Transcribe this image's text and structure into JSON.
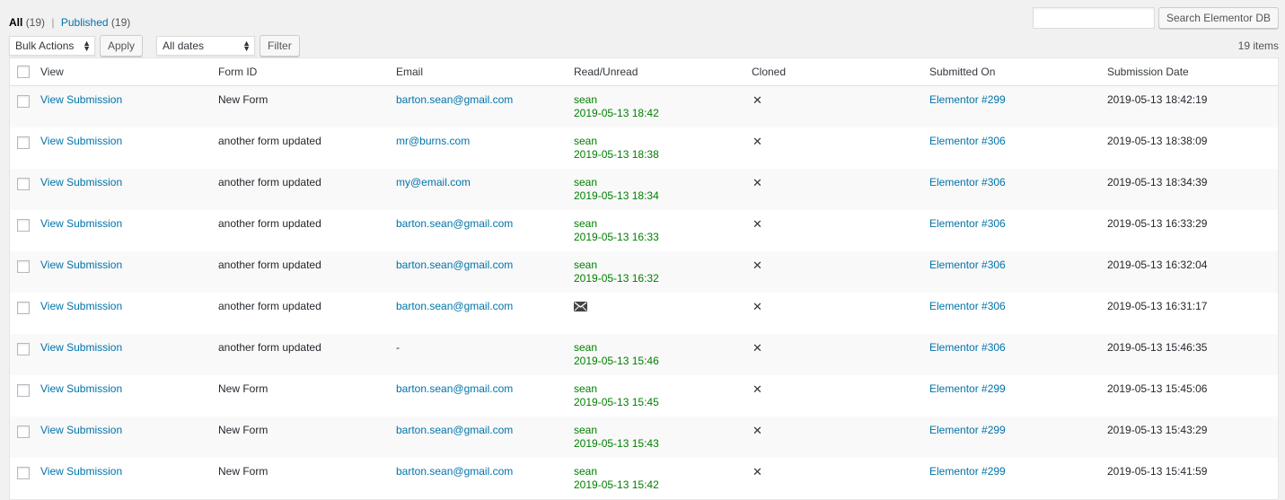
{
  "views": {
    "all_label": "All",
    "all_count": "(19)",
    "separator": "|",
    "published_label": "Published",
    "published_count": "(19)"
  },
  "search": {
    "value": "",
    "button_label": "Search Elementor DB"
  },
  "tablenav": {
    "bulk_actions": "Bulk Actions",
    "apply_label": "Apply",
    "dates": "All dates",
    "filter_label": "Filter",
    "items_count": "19 items"
  },
  "columns": [
    "View",
    "Form ID",
    "Email",
    "Read/Unread",
    "Cloned",
    "Submitted On",
    "Submission Date"
  ],
  "rows": [
    {
      "view": "View Submission",
      "form": "New Form",
      "email": "barton.sean@gmail.com",
      "read_user": "sean",
      "read_time": "2019-05-13 18:42",
      "read": true,
      "cloned": "✕",
      "submitted_on": "Elementor #299",
      "date": "2019-05-13 18:42:19"
    },
    {
      "view": "View Submission",
      "form": "another form updated",
      "email": "mr@burns.com",
      "read_user": "sean",
      "read_time": "2019-05-13 18:38",
      "read": true,
      "cloned": "✕",
      "submitted_on": "Elementor #306",
      "date": "2019-05-13 18:38:09"
    },
    {
      "view": "View Submission",
      "form": "another form updated",
      "email": "my@email.com",
      "read_user": "sean",
      "read_time": "2019-05-13 18:34",
      "read": true,
      "cloned": "✕",
      "submitted_on": "Elementor #306",
      "date": "2019-05-13 18:34:39"
    },
    {
      "view": "View Submission",
      "form": "another form updated",
      "email": "barton.sean@gmail.com",
      "read_user": "sean",
      "read_time": "2019-05-13 16:33",
      "read": true,
      "cloned": "✕",
      "submitted_on": "Elementor #306",
      "date": "2019-05-13 16:33:29"
    },
    {
      "view": "View Submission",
      "form": "another form updated",
      "email": "barton.sean@gmail.com",
      "read_user": "sean",
      "read_time": "2019-05-13 16:32",
      "read": true,
      "cloned": "✕",
      "submitted_on": "Elementor #306",
      "date": "2019-05-13 16:32:04"
    },
    {
      "view": "View Submission",
      "form": "another form updated",
      "email": "barton.sean@gmail.com",
      "read_user": "",
      "read_time": "",
      "read": false,
      "cloned": "✕",
      "submitted_on": "Elementor #306",
      "date": "2019-05-13 16:31:17"
    },
    {
      "view": "View Submission",
      "form": "another form updated",
      "email": "-",
      "read_user": "sean",
      "read_time": "2019-05-13 15:46",
      "read": true,
      "cloned": "✕",
      "submitted_on": "Elementor #306",
      "date": "2019-05-13 15:46:35"
    },
    {
      "view": "View Submission",
      "form": "New Form",
      "email": "barton.sean@gmail.com",
      "read_user": "sean",
      "read_time": "2019-05-13 15:45",
      "read": true,
      "cloned": "✕",
      "submitted_on": "Elementor #299",
      "date": "2019-05-13 15:45:06"
    },
    {
      "view": "View Submission",
      "form": "New Form",
      "email": "barton.sean@gmail.com",
      "read_user": "sean",
      "read_time": "2019-05-13 15:43",
      "read": true,
      "cloned": "✕",
      "submitted_on": "Elementor #299",
      "date": "2019-05-13 15:43:29"
    },
    {
      "view": "View Submission",
      "form": "New Form",
      "email": "barton.sean@gmail.com",
      "read_user": "sean",
      "read_time": "2019-05-13 15:42",
      "read": true,
      "cloned": "✕",
      "submitted_on": "Elementor #299",
      "date": "2019-05-13 15:41:59"
    }
  ],
  "colors": {
    "link": "#0073aa",
    "read_green": "#008000",
    "background": "#f1f1f1"
  }
}
